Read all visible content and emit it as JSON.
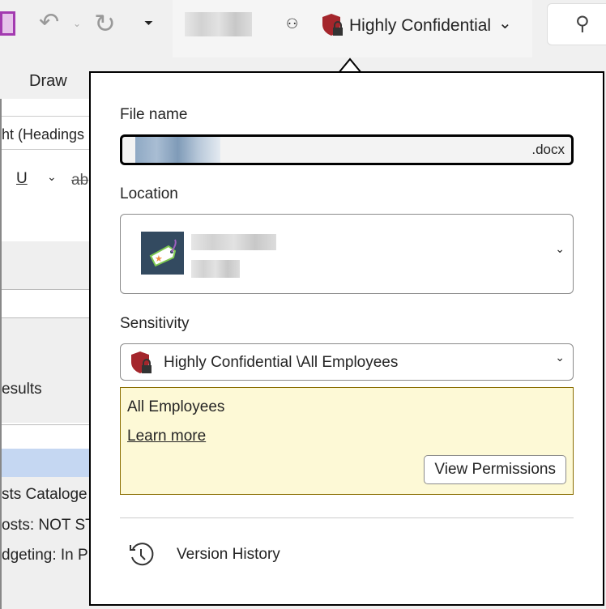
{
  "titlebar": {
    "sensitivity_label": "Highly Confidential",
    "icons": [
      "save-icon",
      "undo-icon",
      "redo-icon",
      "customize-toolbar-icon",
      "share-people-icon",
      "shield-lock-icon",
      "chevron-down-icon",
      "search-icon"
    ]
  },
  "ribbon": {
    "tab_draw": "Draw",
    "font_name": "ht (Headings",
    "underline": "U",
    "strike": "ab"
  },
  "background_doc": {
    "results": "esults",
    "lines": [
      "sts Cataloge",
      "osts: NOT ST",
      "dgeting: In P"
    ]
  },
  "popup": {
    "file_name_label": "File name",
    "file_extension": ".docx",
    "location_label": "Location",
    "sensitivity_label": "Sensitivity",
    "sensitivity_value": "Highly Confidential \\All Employees",
    "info_title": "All Employees",
    "learn_more": "Learn more",
    "view_permissions": "View Permissions",
    "version_history": "Version History"
  },
  "colors": {
    "shield": "#a4262c",
    "info_bg": "#fdf9d6",
    "info_border": "#8a6d00",
    "selected_row": "#c5d7f2"
  }
}
